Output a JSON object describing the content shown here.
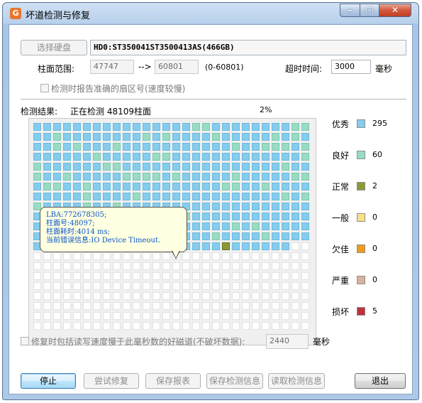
{
  "window": {
    "title": "坏道检测与修复",
    "app_icon_glyph": "G",
    "controls": {
      "minimize": "–",
      "maximize": "□",
      "close": "✕"
    }
  },
  "disk": {
    "select_button": "选择硬盘",
    "disk_name": "HD0:ST350041ST3500413AS(466GB)"
  },
  "range": {
    "label": "柱面范围:",
    "start": "47747",
    "arrow": "-->",
    "end": "60801",
    "total": "(0-60801)"
  },
  "timeout": {
    "label": "超时时间:",
    "value": "3000",
    "unit": "毫秒"
  },
  "report_option": "检测时报告准确的扇区号(速度较慢)",
  "status": {
    "label": "检测结果:",
    "text": "正在检测 48109柱面",
    "percent": "2%"
  },
  "legend": [
    {
      "label": "优秀",
      "count": "295",
      "color": "#84cdee"
    },
    {
      "label": "良好",
      "count": "60",
      "color": "#98dcc5"
    },
    {
      "label": "正常",
      "count": "2",
      "color": "#8b9a37"
    },
    {
      "label": "一般",
      "count": "0",
      "color": "#f7e08a"
    },
    {
      "label": "欠佳",
      "count": "0",
      "color": "#f29a1d"
    },
    {
      "label": "严重",
      "count": "0",
      "color": "#d5b39a"
    },
    {
      "label": "损坏",
      "count": "5",
      "color": "#c0313a"
    }
  ],
  "colors": {
    "empty_cell": "#ffffff",
    "grid_bg": "#f0f0f0"
  },
  "tooltip": {
    "lba": "LBA:772678305;",
    "cylinder": "柱面号:48097;",
    "time": "柱面耗时:4014 ms;",
    "error": "当前错误信息:IO Device Timeout."
  },
  "repair_option": {
    "label": "修复时包括读写速度慢于此毫秒数的好磁道(不破坏数据):",
    "value": "2440",
    "unit": "毫秒"
  },
  "buttons": {
    "stop": "停止",
    "try_repair": "尝试修复",
    "save_report": "保存报表",
    "save_info": "保存检测信息",
    "read_info": "读取检测信息",
    "exit": "退出"
  }
}
